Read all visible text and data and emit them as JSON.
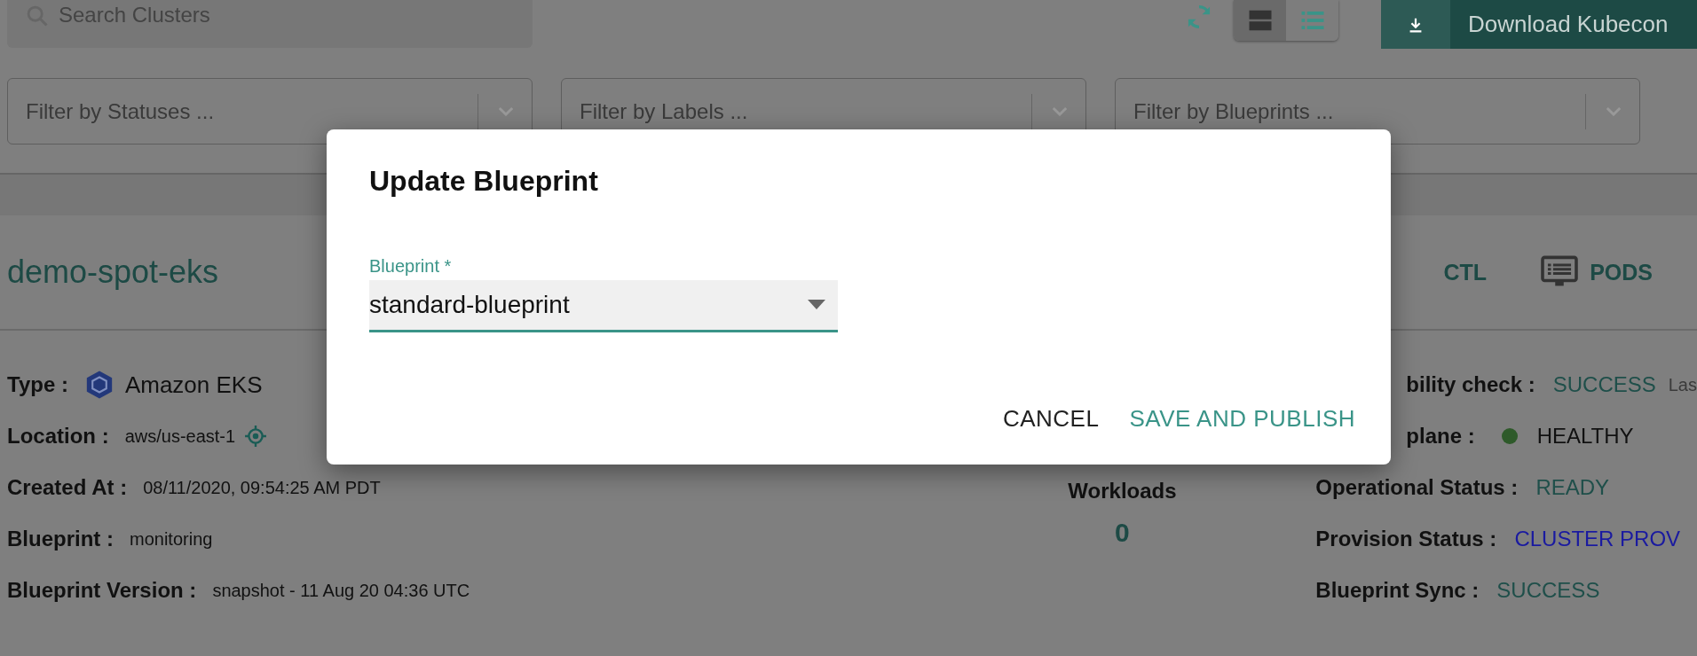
{
  "toolbar": {
    "search": {
      "placeholder": "Search Clusters"
    },
    "view_toggle": [
      {
        "kind": "cards",
        "selected": true
      },
      {
        "kind": "list",
        "selected": false
      }
    ],
    "download_button": {
      "label": "Download Kubecon"
    }
  },
  "filters": [
    {
      "placeholder": "Filter by Statuses ..."
    },
    {
      "placeholder": "Filter by Labels ..."
    },
    {
      "placeholder": "Filter by Blueprints ..."
    }
  ],
  "cluster": {
    "name": "demo-spot-eks",
    "actions": [
      {
        "label": "CTL",
        "kind": "text"
      },
      {
        "label": "PODS",
        "kind": "pods"
      }
    ],
    "details": [
      {
        "label": "Type :",
        "value": "Amazon EKS",
        "kind": "type"
      },
      {
        "label": "Location :",
        "value": "aws/us-east-1",
        "kind": "location"
      },
      {
        "label": "Created At :",
        "value": "08/11/2020, 09:54:25 AM PDT",
        "kind": "plain"
      },
      {
        "label": "Blueprint :",
        "value": "monitoring",
        "kind": "plain"
      },
      {
        "label": "Blueprint Version :",
        "value": "snapshot - 11 Aug 20 04:36 UTC",
        "kind": "plain"
      }
    ],
    "workloads": {
      "label": "Workloads",
      "value": "0"
    },
    "status": [
      {
        "label": "bility check :",
        "value": "SUCCESS",
        "color": "#1f4f4a",
        "note": "Las"
      },
      {
        "label": "plane :",
        "value": "HEALTHY",
        "color": "#111111",
        "dot": {
          "color": "#2e5a2a"
        }
      },
      {
        "label": "Operational Status :",
        "value": "READY",
        "color": "#1f4f4a"
      },
      {
        "label": "Provision Status :",
        "value": "CLUSTER PROV",
        "color": "#1a1aa0"
      },
      {
        "label": "Blueprint Sync :",
        "value": "SUCCESS",
        "color": "#1f4f4a"
      }
    ]
  },
  "dialog": {
    "title": "Update Blueprint",
    "field": {
      "label": "Blueprint *",
      "value": "standard-blueprint"
    },
    "buttons": [
      {
        "label": "CANCEL",
        "kind": "secondary"
      },
      {
        "label": "SAVE AND PUBLISH",
        "kind": "primary"
      }
    ]
  }
}
